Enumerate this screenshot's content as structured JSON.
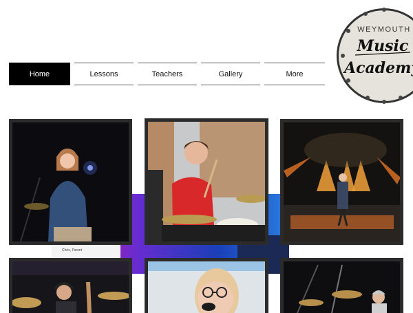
{
  "logo": {
    "line1": "WEYMOUTH",
    "line2": "Music",
    "line3": "Academy"
  },
  "nav": [
    {
      "label": "Home",
      "active": true
    },
    {
      "label": "Lessons"
    },
    {
      "label": "Teachers"
    },
    {
      "label": "Gallery"
    },
    {
      "label": "More"
    }
  ],
  "background_caption": "Chris, Parent",
  "photos": [
    {
      "subject": "singer-with-microphone"
    },
    {
      "subject": "drummer-in-red-shirt"
    },
    {
      "subject": "performer-on-stage-with-lights"
    },
    {
      "subject": "drummer-with-headphones"
    },
    {
      "subject": "singer-with-glasses"
    },
    {
      "subject": "drummer-on-dark-stage"
    }
  ],
  "colors": {
    "nav_active_bg": "#000000",
    "nav_active_text": "#ffffff",
    "tile_border": "#2b2b2b",
    "logo_bg": "#e6e3dc"
  }
}
